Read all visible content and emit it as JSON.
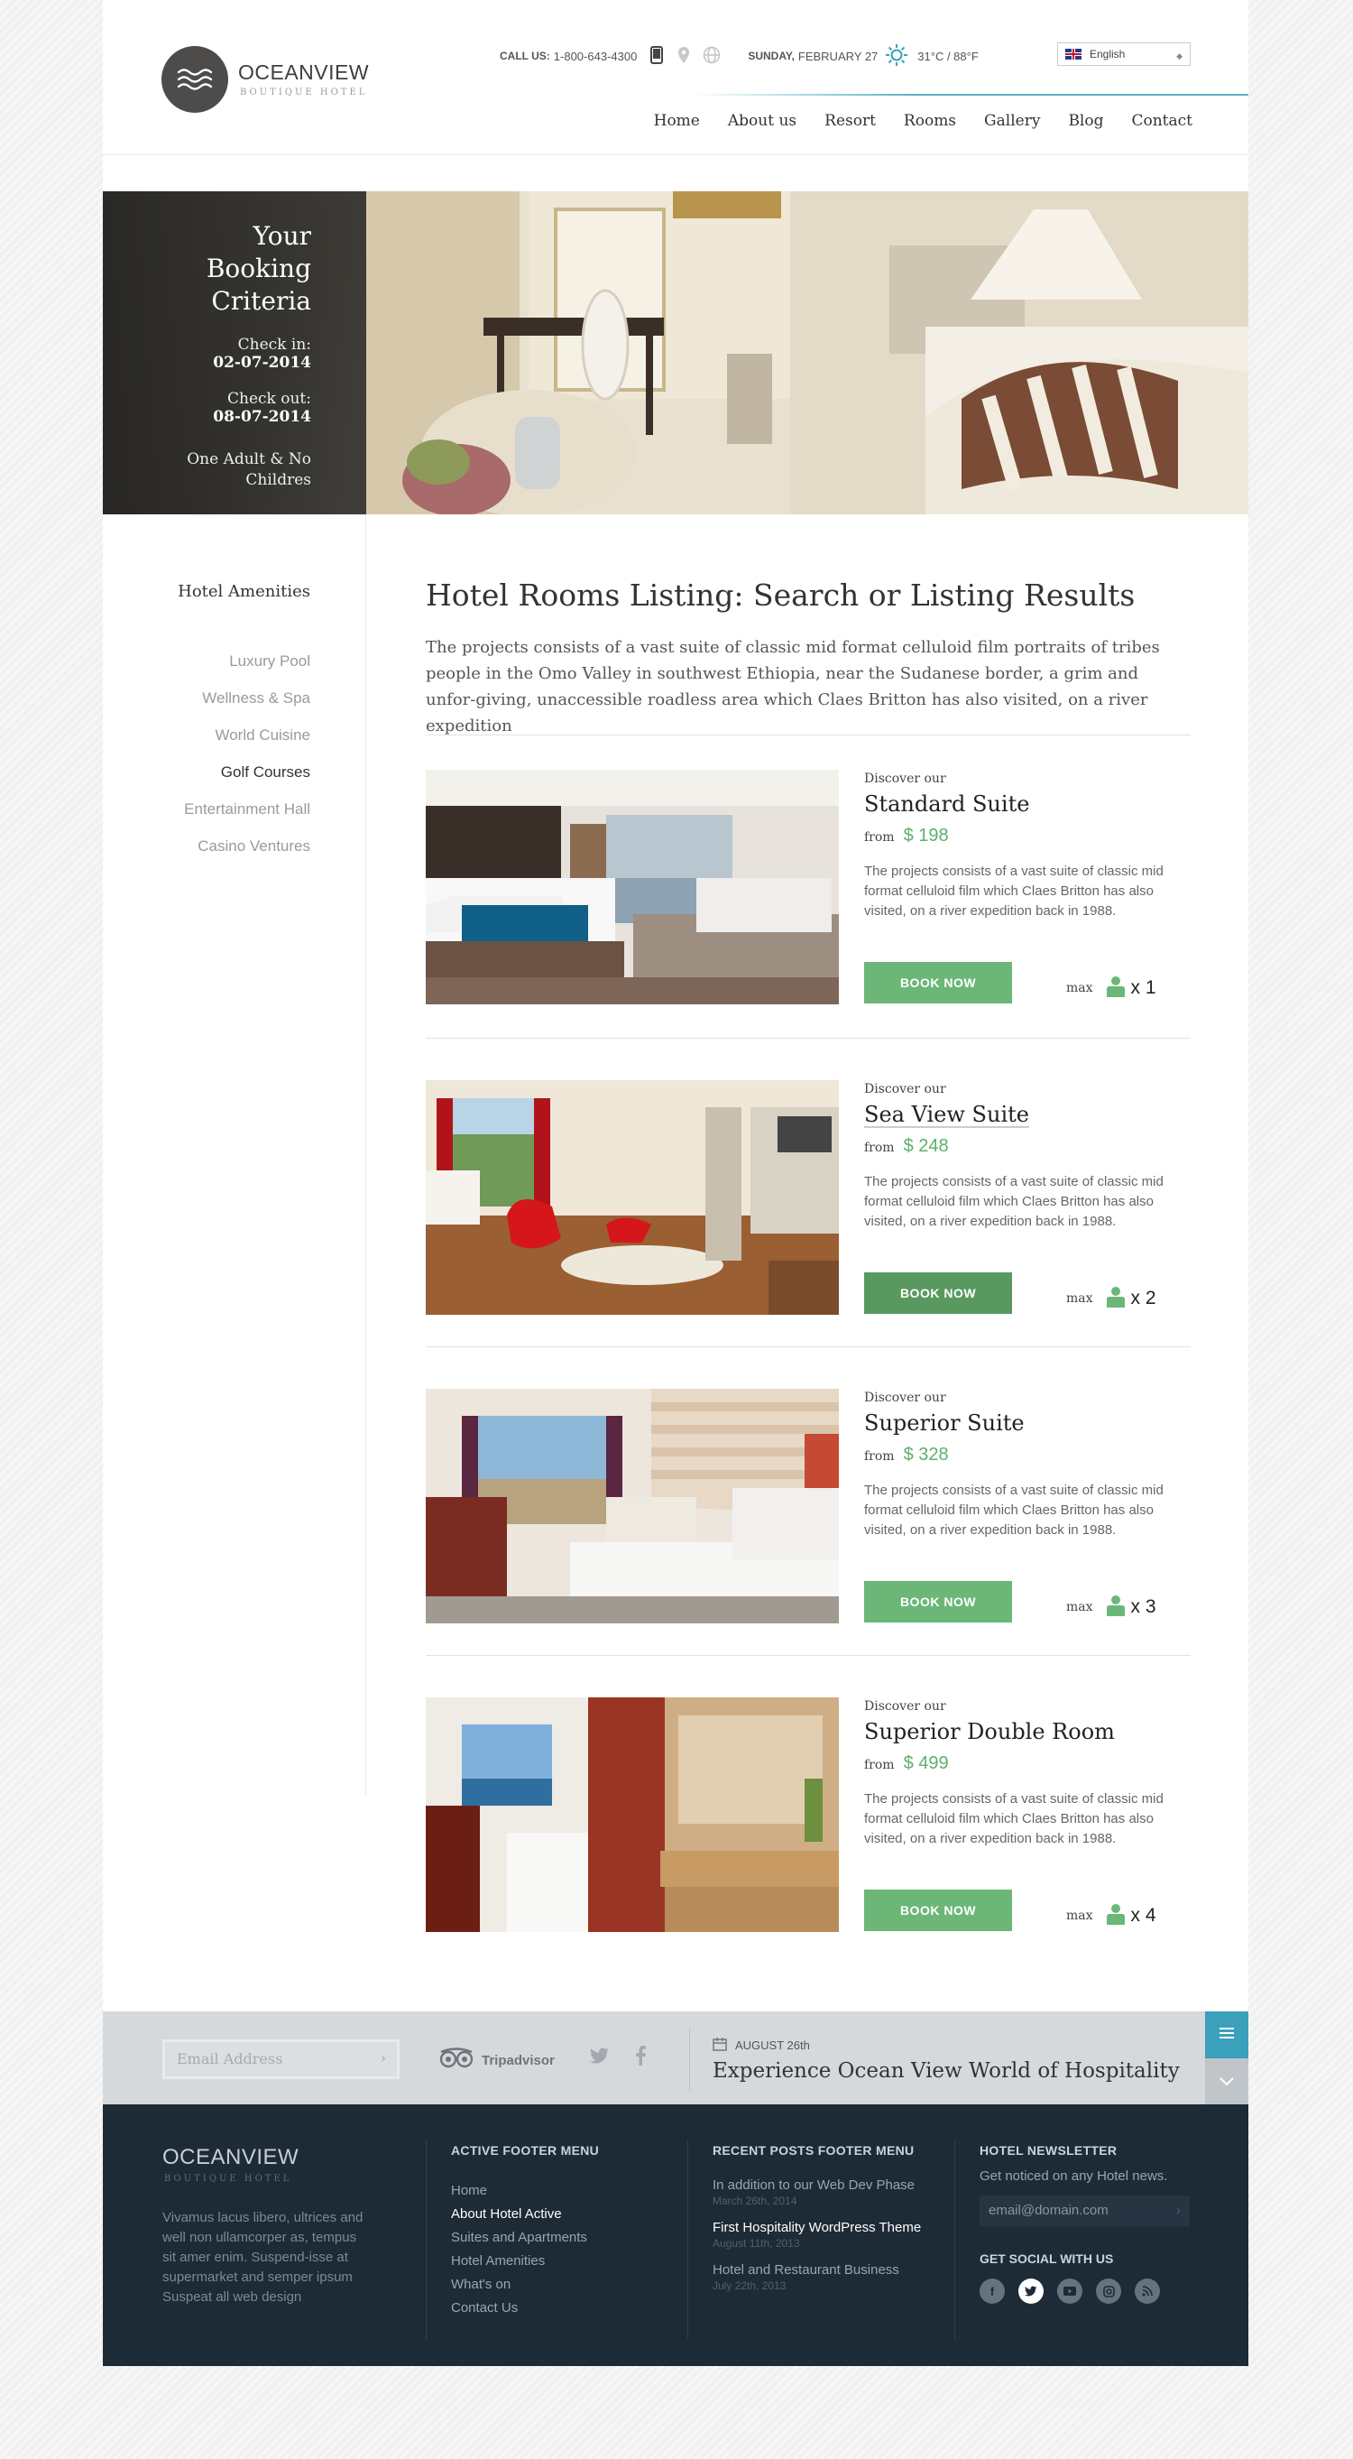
{
  "header": {
    "logo_name": "OCEANVIEW",
    "logo_sub": "BOUTIQUE HOTEL",
    "call_label": "CALL US:",
    "phone": "1-800-643-4300",
    "date_day": "SUNDAY,",
    "date_rest": "FEBRUARY 27",
    "weather": "31°C / 88°F",
    "language": "English",
    "nav": [
      "Home",
      "About us",
      "Resort",
      "Rooms",
      "Gallery",
      "Blog",
      "Contact"
    ]
  },
  "booking": {
    "title": "Your Booking Criteria",
    "checkin_label": "Check in:",
    "checkin": "02-07-2014",
    "checkout_label": "Check out:",
    "checkout": "08-07-2014",
    "guests": "One Adult & No Childres"
  },
  "sidebar": {
    "title": "Hotel Amenities",
    "items": [
      "Luxury Pool",
      "Wellness & Spa",
      "World Cuisine",
      "Golf Courses",
      "Entertainment Hall",
      "Casino Ventures"
    ],
    "active": "Golf Courses"
  },
  "content": {
    "title": "Hotel Rooms Listing: Search or Listing Results",
    "intro": "The projects consists of a vast suite of classic mid format celluloid film portraits of tribes people in the Omo Valley in southwest Ethiopia, near the Sudanese border, a grim and unfor-giving, unaccessible roadless area which Claes Britton has also visited, on a river expedition",
    "discover_label": "Discover our",
    "from_label": "from",
    "book_label": "BOOK NOW",
    "max_label": "max",
    "rooms": [
      {
        "name": "Standard Suite",
        "price": "$ 198",
        "max": "x 1",
        "desc": "The projects consists of a vast suite of classic mid format celluloid film which Claes Britton has also visited, on a river expedition back in 1988."
      },
      {
        "name": "Sea View Suite",
        "price": "$ 248",
        "max": "x 2",
        "desc": "The projects consists of a vast suite of classic mid format celluloid film which Claes Britton has also visited, on a river expedition back in 1988."
      },
      {
        "name": "Superior Suite",
        "price": "$ 328",
        "max": "x 3",
        "desc": "The projects consists of a vast suite of classic mid format celluloid film which Claes Britton has also visited, on a river expedition back in 1988."
      },
      {
        "name": "Superior Double Room",
        "price": "$ 499",
        "max": "x 4",
        "desc": "The projects consists of a vast suite of classic mid format celluloid film which Claes Britton has also visited, on a river expedition back in 1988."
      }
    ]
  },
  "strip": {
    "email_placeholder": "Email Address",
    "tripadvisor": "Tripadvisor",
    "post_date": "AUGUST 26th",
    "post_title": "Experience Ocean View World of Hospitality"
  },
  "footer": {
    "logo_name": "OCEANVIEW",
    "logo_sub": "BOUTIQUE HOTEL",
    "about": "Vivamus lacus libero, ultrices and well non ullamcorper as, tempus sit amer enim. Suspend-isse at supermarket and semper ipsum Suspeat all web design",
    "menu_title": "ACTIVE FOOTER MENU",
    "menu": [
      "Home",
      "About Hotel Active",
      "Suites and Apartments",
      "Hotel Amenities",
      "What's on",
      "Contact Us"
    ],
    "posts_title": "RECENT POSTS FOOTER MENU",
    "posts": [
      {
        "title": "In addition to our Web Dev Phase",
        "date": "March 26th, 2014"
      },
      {
        "title": "First Hospitality WordPress Theme",
        "date": "August 11th, 2013"
      },
      {
        "title": "Hotel and Restaurant Business",
        "date": "July 22th, 2013"
      }
    ],
    "newsletter_title": "HOTEL NEWSLETTER",
    "newsletter_sub": "Get noticed on any Hotel news.",
    "newsletter_value": "email@domain.com",
    "social_title": "GET SOCIAL WITH US"
  },
  "colors": {
    "accent_green": "#6cb778",
    "accent_blue": "#3aa0bb",
    "footer_bg": "#1d2b37"
  }
}
